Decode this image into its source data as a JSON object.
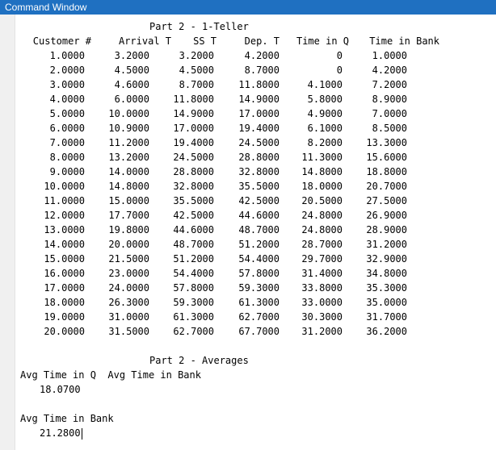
{
  "window": {
    "title": "Command Window"
  },
  "part1": {
    "title": "Part 2 - 1-Teller",
    "headers": [
      "Customer #",
      "Arrival T",
      "SS T",
      "Dep. T",
      "Time in Q",
      "Time in Bank"
    ],
    "rows": [
      [
        "1.0000",
        "3.2000",
        "3.2000",
        "4.2000",
        "0",
        "1.0000"
      ],
      [
        "2.0000",
        "4.5000",
        "4.5000",
        "8.7000",
        "0",
        "4.2000"
      ],
      [
        "3.0000",
        "4.6000",
        "8.7000",
        "11.8000",
        "4.1000",
        "7.2000"
      ],
      [
        "4.0000",
        "6.0000",
        "11.8000",
        "14.9000",
        "5.8000",
        "8.9000"
      ],
      [
        "5.0000",
        "10.0000",
        "14.9000",
        "17.0000",
        "4.9000",
        "7.0000"
      ],
      [
        "6.0000",
        "10.9000",
        "17.0000",
        "19.4000",
        "6.1000",
        "8.5000"
      ],
      [
        "7.0000",
        "11.2000",
        "19.4000",
        "24.5000",
        "8.2000",
        "13.3000"
      ],
      [
        "8.0000",
        "13.2000",
        "24.5000",
        "28.8000",
        "11.3000",
        "15.6000"
      ],
      [
        "9.0000",
        "14.0000",
        "28.8000",
        "32.8000",
        "14.8000",
        "18.8000"
      ],
      [
        "10.0000",
        "14.8000",
        "32.8000",
        "35.5000",
        "18.0000",
        "20.7000"
      ],
      [
        "11.0000",
        "15.0000",
        "35.5000",
        "42.5000",
        "20.5000",
        "27.5000"
      ],
      [
        "12.0000",
        "17.7000",
        "42.5000",
        "44.6000",
        "24.8000",
        "26.9000"
      ],
      [
        "13.0000",
        "19.8000",
        "44.6000",
        "48.7000",
        "24.8000",
        "28.9000"
      ],
      [
        "14.0000",
        "20.0000",
        "48.7000",
        "51.2000",
        "28.7000",
        "31.2000"
      ],
      [
        "15.0000",
        "21.5000",
        "51.2000",
        "54.4000",
        "29.7000",
        "32.9000"
      ],
      [
        "16.0000",
        "23.0000",
        "54.4000",
        "57.8000",
        "31.4000",
        "34.8000"
      ],
      [
        "17.0000",
        "24.0000",
        "57.8000",
        "59.3000",
        "33.8000",
        "35.3000"
      ],
      [
        "18.0000",
        "26.3000",
        "59.3000",
        "61.3000",
        "33.0000",
        "35.0000"
      ],
      [
        "19.0000",
        "31.0000",
        "61.3000",
        "62.7000",
        "30.3000",
        "31.7000"
      ],
      [
        "20.0000",
        "31.5000",
        "62.7000",
        "67.7000",
        "31.2000",
        "36.2000"
      ]
    ]
  },
  "part2": {
    "title": "Part 2 - Averages",
    "header_line": "Avg Time in Q  Avg Time in Bank",
    "avg_q_value": "18.0700",
    "avg_bank_label": "Avg Time in Bank",
    "avg_bank_value": "21.2800"
  }
}
